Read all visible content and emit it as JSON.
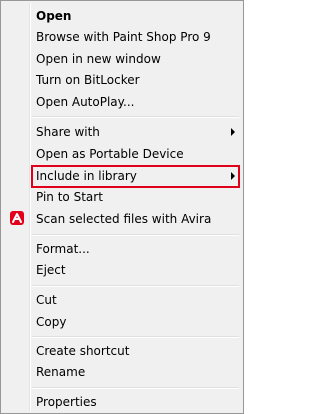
{
  "menu": {
    "items": {
      "open": {
        "label": "Open"
      },
      "browse_paint_shop": {
        "label": "Browse with Paint Shop Pro 9"
      },
      "open_new_window": {
        "label": "Open in new window"
      },
      "turn_on_bitlocker": {
        "label": "Turn on BitLocker"
      },
      "open_autoplay": {
        "label": "Open AutoPlay..."
      },
      "share_with": {
        "label": "Share with",
        "submenu": true
      },
      "open_portable_device": {
        "label": "Open as Portable Device"
      },
      "include_in_library": {
        "label": "Include in library",
        "submenu": true
      },
      "pin_to_start": {
        "label": "Pin to Start"
      },
      "scan_avira": {
        "label": "Scan selected files with Avira",
        "icon": "avira-icon"
      },
      "format": {
        "label": "Format..."
      },
      "eject": {
        "label": "Eject"
      },
      "cut": {
        "label": "Cut"
      },
      "copy": {
        "label": "Copy"
      },
      "create_shortcut": {
        "label": "Create shortcut"
      },
      "rename": {
        "label": "Rename"
      },
      "properties": {
        "label": "Properties"
      }
    }
  },
  "colors": {
    "highlight_box": "#e0001b",
    "menu_background": "#f0f0f0",
    "avira_red": "#e2001a"
  }
}
